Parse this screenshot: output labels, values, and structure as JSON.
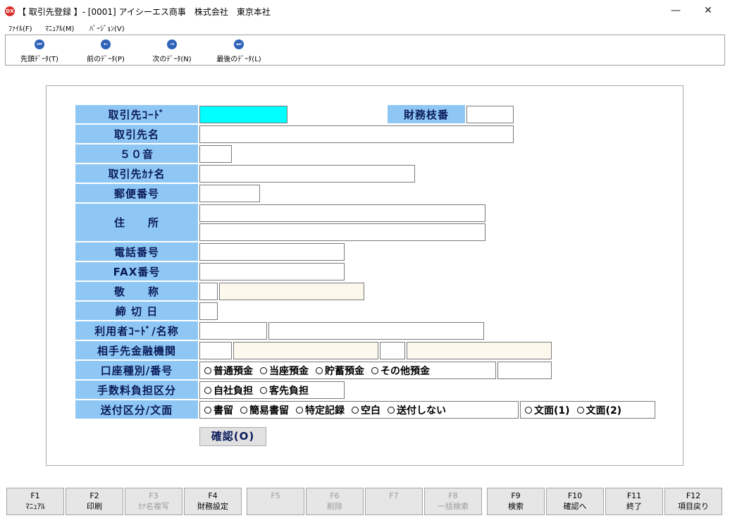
{
  "window": {
    "title": "【 取引先登録 】- [0001] アイシーエス商事　株式会社　東京本社",
    "icon_text": "DX",
    "minimize": "—",
    "maximize": "❐",
    "close": "✕"
  },
  "menu": [
    {
      "label": "ﾌｧｲﾙ(F)"
    },
    {
      "label": "ﾏﾆｭｱﾙ(M)"
    },
    {
      "label": "ﾊﾞｰｼﾞｮﾝ(V)"
    }
  ],
  "toolbar": [
    {
      "label": "先頭ﾃﾞｰﾀ(T)",
      "icon": "first-record-icon",
      "glyph": "⏮"
    },
    {
      "label": "前のﾃﾞｰﾀ(P)",
      "icon": "previous-record-icon",
      "glyph": "←"
    },
    {
      "label": "次のﾃﾞｰﾀ(N)",
      "icon": "next-record-icon",
      "glyph": "→"
    },
    {
      "label": "最後のﾃﾞｰﾀ(L)",
      "icon": "last-record-icon",
      "glyph": "⏭"
    }
  ],
  "form": {
    "labels": {
      "code": "取引先ｺｰﾄﾞ",
      "zaimu": "財務枝番",
      "name": "取引先名",
      "gojuon": "５０音",
      "kana": "取引先ｶﾅ名",
      "zip": "郵便番号",
      "address": "住　　所",
      "tel": "電話番号",
      "fax": "FAX番号",
      "honorific": "敬　　称",
      "closing": "締 切 日",
      "user": "利用者ｺｰﾄﾞ/名称",
      "bank": "相手先金融機関",
      "account": "口座種別/番号",
      "fee": "手数料負担区分",
      "send": "送付区分/文面"
    },
    "account_types": [
      "普通預金",
      "当座預金",
      "貯蓄預金",
      "その他預金"
    ],
    "fee_options": [
      "自社負担",
      "客先負担"
    ],
    "send_options": [
      "書留",
      "簡易書留",
      "特定記録",
      "空白",
      "送付しない"
    ],
    "letter_options": [
      "文面(1)",
      "文面(2)"
    ],
    "confirm_button": "確認(O)"
  },
  "function_keys": [
    {
      "key": "F1",
      "label": "ﾏﾆｭｱﾙ",
      "enabled": true
    },
    {
      "key": "F2",
      "label": "印刷",
      "enabled": true
    },
    {
      "key": "F3",
      "label": "ｶﾅ名複写",
      "enabled": false
    },
    {
      "key": "F4",
      "label": "財務設定",
      "enabled": true
    },
    {
      "key": "F5",
      "label": "",
      "enabled": false
    },
    {
      "key": "F6",
      "label": "削除",
      "enabled": false
    },
    {
      "key": "F7",
      "label": "",
      "enabled": false
    },
    {
      "key": "F8",
      "label": "一括検索",
      "enabled": false
    },
    {
      "key": "F9",
      "label": "検索",
      "enabled": true
    },
    {
      "key": "F10",
      "label": "確認へ",
      "enabled": true
    },
    {
      "key": "F11",
      "label": "終了",
      "enabled": true
    },
    {
      "key": "F12",
      "label": "項目戻り",
      "enabled": true
    }
  ],
  "colors": {
    "label_bg": "#8fc7f4",
    "label_text": "#0b1c5c",
    "focused_input": "#00ffff",
    "readonly_input": "#fdf8ee"
  }
}
